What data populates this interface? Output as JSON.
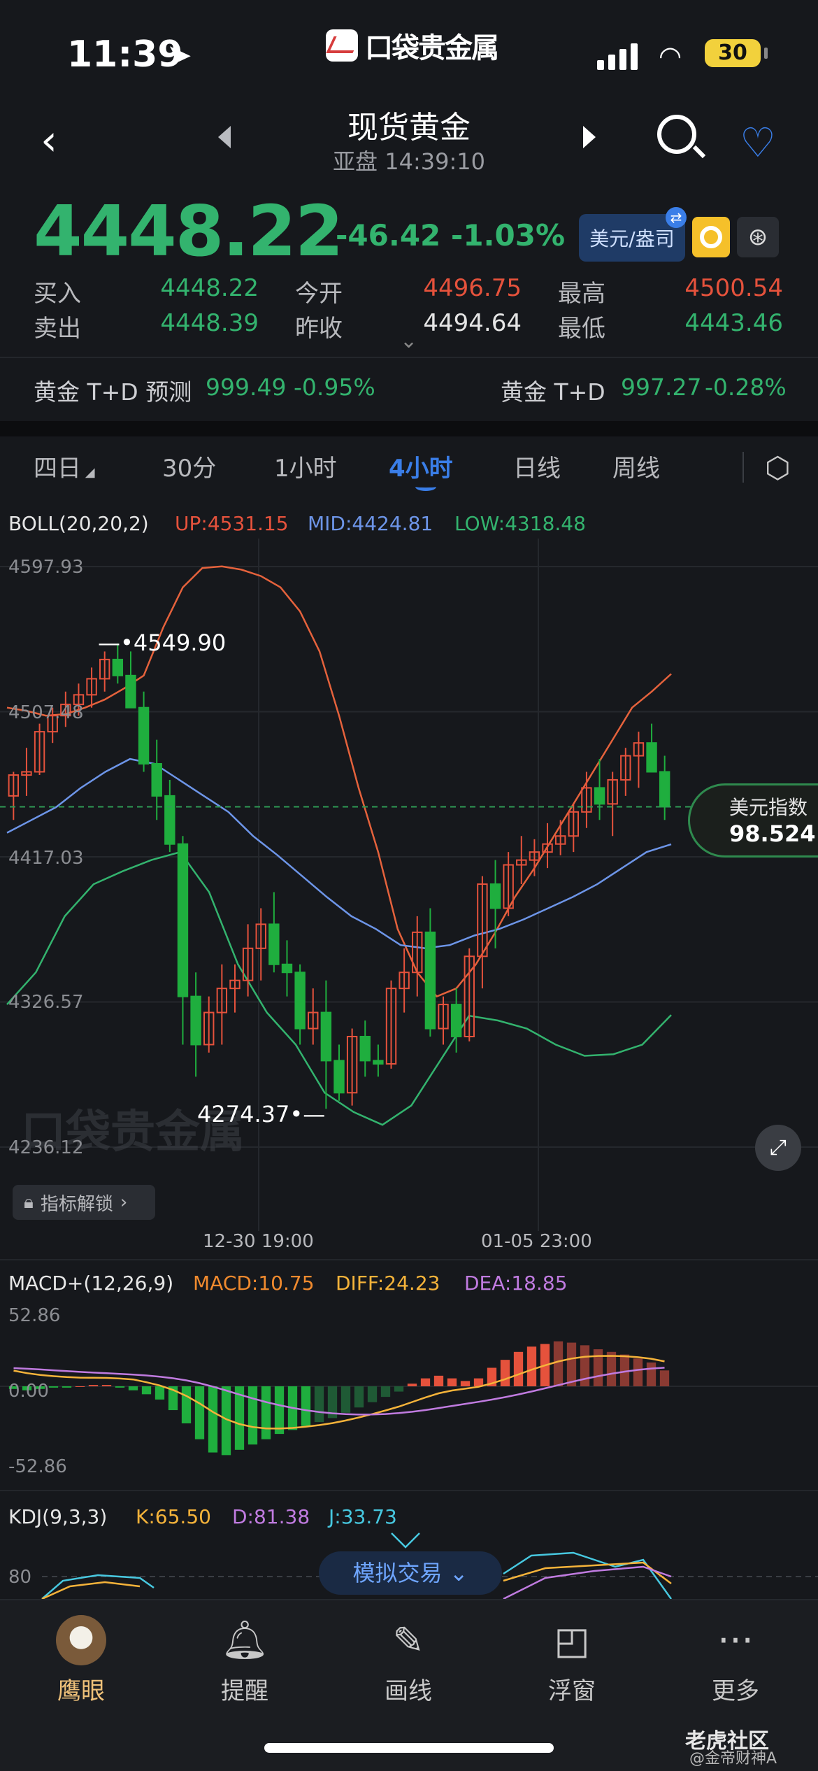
{
  "status_bar": {
    "time": "11:39",
    "brand": "口袋贵金属",
    "battery": "30"
  },
  "header": {
    "title": "现货黄金",
    "subtitle": "亚盘 14:39:10"
  },
  "quote": {
    "price": "4448.22",
    "change": "-46.42 -1.03%",
    "fx_button": "美元/盎司",
    "rows": [
      {
        "l1": "买入",
        "v1": "4448.22",
        "l2": "今开",
        "v2": "4496.75",
        "l3": "最高",
        "v3": "4500.54"
      },
      {
        "l1": "卖出",
        "v1": "4448.39",
        "l2": "昨收",
        "v2": "4494.64",
        "l3": "最低",
        "v3": "4443.46"
      }
    ]
  },
  "td": {
    "left_label": "黄金 T+D 预测",
    "left_value": "999.49",
    "left_change": "-0.95%",
    "right_label": "黄金 T+D",
    "right_value": "997.27",
    "right_change": "-0.28%"
  },
  "tabs": [
    {
      "label": "四日"
    },
    {
      "label": "30分"
    },
    {
      "label": "1小时"
    },
    {
      "label": "4小时"
    },
    {
      "label": "日线"
    },
    {
      "label": "周线"
    }
  ],
  "boll": {
    "name": "BOLL(20,20,2)",
    "up": "UP:4531.15",
    "mid": "MID:4424.81",
    "low": "LOW:4318.48"
  },
  "price_axis": [
    "4597.93",
    "4507.48",
    "4417.03",
    "4326.57",
    "4236.12"
  ],
  "annotations": {
    "high": "4549.90",
    "low": "4274.37"
  },
  "time_axis": [
    "12-30 19:00",
    "01-05 23:00"
  ],
  "usdx": {
    "label": "美元指数",
    "value": "98.524"
  },
  "lock_label": "指标解锁",
  "macd": {
    "name": "MACD+(12,26,9)",
    "macd": "MACD:10.75",
    "diff": "DIFF:24.23",
    "dea": "DEA:18.85",
    "axis": [
      "52.86",
      "0.00",
      "-52.86"
    ]
  },
  "kdj": {
    "name": "KDJ(9,3,3)",
    "k": "K:65.50",
    "d": "D:81.38",
    "j": "J:33.73",
    "axis": "80"
  },
  "sim_trade": "模拟交易",
  "bottom_nav": [
    {
      "label": "鹰眼"
    },
    {
      "label": "提醒"
    },
    {
      "label": "画线"
    },
    {
      "label": "浮窗"
    },
    {
      "label": "更多"
    }
  ],
  "watermark": {
    "main": "老虎社区",
    "sub": "@金帝财神A"
  },
  "colors": {
    "up": "#e5523c",
    "down": "#33b36e",
    "accent": "#3a7ee8",
    "mid": "#6d95e8",
    "orange": "#f08a2e",
    "violet": "#c07be0"
  },
  "chart_data": [
    {
      "type": "candlestick",
      "title": "",
      "ylim": [
        4236.12,
        4597.93
      ],
      "y_ticks": [
        4597.93,
        4507.48,
        4417.03,
        4326.57,
        4236.12
      ],
      "x_ticks": [
        "12-30 19:00",
        "01-05 23:00"
      ],
      "annotations": [
        {
          "label": "4549.90",
          "value": 4549.9
        },
        {
          "label": "4274.37",
          "value": 4274.37
        }
      ],
      "ohlc": [
        [
          4455,
          4470,
          4440,
          4468
        ],
        [
          4468,
          4485,
          4455,
          4470
        ],
        [
          4470,
          4500,
          4468,
          4495
        ],
        [
          4495,
          4510,
          4488,
          4505
        ],
        [
          4505,
          4520,
          4498,
          4512
        ],
        [
          4512,
          4525,
          4505,
          4518
        ],
        [
          4518,
          4535,
          4510,
          4528
        ],
        [
          4528,
          4545,
          4520,
          4540
        ],
        [
          4540,
          4550,
          4525,
          4530
        ],
        [
          4530,
          4545,
          4515,
          4510
        ],
        [
          4510,
          4520,
          4470,
          4475
        ],
        [
          4475,
          4490,
          4440,
          4455
        ],
        [
          4455,
          4465,
          4420,
          4425
        ],
        [
          4425,
          4430,
          4300,
          4330
        ],
        [
          4330,
          4345,
          4280,
          4300
        ],
        [
          4300,
          4330,
          4295,
          4320
        ],
        [
          4320,
          4350,
          4300,
          4335
        ],
        [
          4335,
          4350,
          4320,
          4340
        ],
        [
          4340,
          4375,
          4330,
          4360
        ],
        [
          4360,
          4385,
          4340,
          4375
        ],
        [
          4375,
          4395,
          4345,
          4350
        ],
        [
          4350,
          4365,
          4330,
          4345
        ],
        [
          4345,
          4350,
          4300,
          4310
        ],
        [
          4310,
          4335,
          4300,
          4320
        ],
        [
          4320,
          4340,
          4260,
          4290
        ],
        [
          4290,
          4300,
          4265,
          4270
        ],
        [
          4270,
          4310,
          4262,
          4305
        ],
        [
          4305,
          4315,
          4280,
          4290
        ],
        [
          4290,
          4300,
          4280,
          4288
        ],
        [
          4288,
          4340,
          4285,
          4335
        ],
        [
          4335,
          4360,
          4320,
          4345
        ],
        [
          4345,
          4380,
          4330,
          4370
        ],
        [
          4370,
          4385,
          4305,
          4310
        ],
        [
          4310,
          4330,
          4300,
          4325
        ],
        [
          4325,
          4335,
          4295,
          4305
        ],
        [
          4305,
          4360,
          4302,
          4355
        ],
        [
          4355,
          4405,
          4335,
          4400
        ],
        [
          4400,
          4415,
          4360,
          4385
        ],
        [
          4385,
          4420,
          4380,
          4412
        ],
        [
          4412,
          4430,
          4400,
          4415
        ],
        [
          4415,
          4428,
          4405,
          4420
        ],
        [
          4420,
          4438,
          4410,
          4425
        ],
        [
          4425,
          4440,
          4418,
          4430
        ],
        [
          4430,
          4450,
          4420,
          4445
        ],
        [
          4445,
          4470,
          4435,
          4460
        ],
        [
          4460,
          4478,
          4440,
          4450
        ],
        [
          4450,
          4470,
          4430,
          4465
        ],
        [
          4465,
          4485,
          4455,
          4480
        ],
        [
          4480,
          4495,
          4460,
          4488
        ],
        [
          4488,
          4500,
          4470,
          4470
        ],
        [
          4470,
          4480,
          4440,
          4448.22
        ]
      ],
      "boll": {
        "up": [
          4510,
          4508,
          4505,
          4506,
          4510,
          4515,
          4522,
          4530,
          4560,
          4585,
          4597,
          4598,
          4596,
          4592,
          4585,
          4570,
          4545,
          4505,
          4460,
          4420,
          4372,
          4345,
          4330,
          4335,
          4350,
          4370,
          4392,
          4410,
          4430,
          4450,
          4470,
          4490,
          4510,
          4520,
          4531
        ],
        "mid": [
          4432,
          4440,
          4448,
          4460,
          4470,
          4478,
          4475,
          4465,
          4455,
          4445,
          4430,
          4418,
          4405,
          4392,
          4380,
          4372,
          4362,
          4360,
          4362,
          4368,
          4372,
          4378,
          4385,
          4392,
          4400,
          4410,
          4420,
          4424.81
        ],
        "low": [
          4325,
          4345,
          4380,
          4400,
          4408,
          4415,
          4420,
          4395,
          4350,
          4320,
          4300,
          4270,
          4258,
          4250,
          4262,
          4290,
          4318,
          4315,
          4310,
          4300,
          4293,
          4294,
          4300,
          4318.48
        ]
      },
      "reference_line": 4448.22
    },
    {
      "type": "bar",
      "title": "MACD+(12,26,9)",
      "ylim": [
        -52.86,
        52.86
      ],
      "values": [
        -2,
        -3,
        -2,
        -1,
        -1,
        0,
        1,
        1,
        -1,
        -3,
        -6,
        -10,
        -18,
        -28,
        -40,
        -50,
        -52,
        -48,
        -44,
        -40,
        -36,
        -33,
        -30,
        -27,
        -24,
        -20,
        -16,
        -12,
        -8,
        -4,
        2,
        6,
        8,
        6,
        4,
        6,
        14,
        20,
        26,
        30,
        32,
        34,
        33,
        31,
        28,
        26,
        24,
        21,
        18,
        12
      ]
    }
  ]
}
